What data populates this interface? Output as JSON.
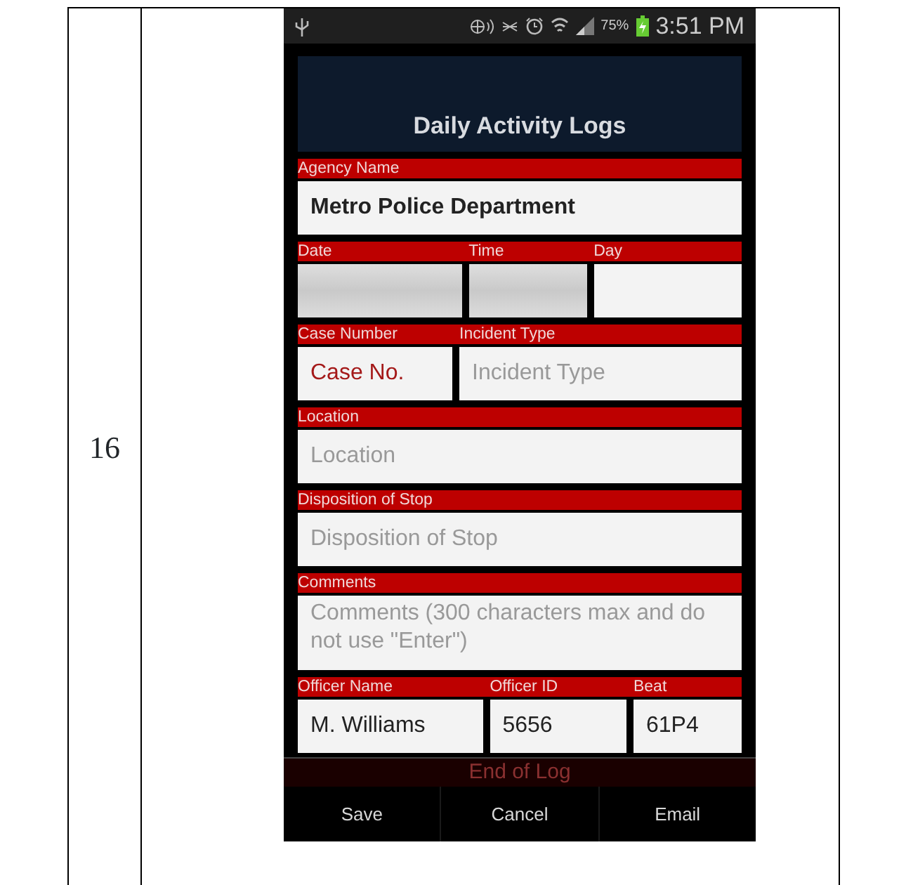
{
  "document_table": {
    "row_number": "16"
  },
  "status_bar": {
    "battery": "75%",
    "time": "3:51 PM"
  },
  "app": {
    "title": "Daily Activity Logs",
    "rows": [
      {
        "columns": [
          {
            "label": "Agency Name",
            "kind": "text",
            "value": "Metro Police Department",
            "bold": true
          }
        ]
      },
      {
        "columns": [
          {
            "label": "Date",
            "kind": "picker"
          },
          {
            "label": "Time",
            "kind": "picker"
          },
          {
            "label": "Day",
            "kind": "text"
          }
        ]
      },
      {
        "columns": [
          {
            "label": "Case Number",
            "kind": "text",
            "value": "Case No.",
            "bold": false,
            "invalid": true
          },
          {
            "label": "Incident Type",
            "kind": "text",
            "placeholder": "Incident Type"
          }
        ]
      },
      {
        "columns": [
          {
            "label": "Location",
            "kind": "text",
            "placeholder": "Location"
          }
        ]
      },
      {
        "columns": [
          {
            "label": "Disposition of Stop",
            "kind": "text",
            "placeholder": "Disposition of Stop"
          }
        ]
      },
      {
        "columns": [
          {
            "label": "Comments",
            "kind": "textarea",
            "placeholder": "Comments (300 characters max and do not use \"Enter\")"
          }
        ]
      },
      {
        "columns": [
          {
            "label": "Officer Name",
            "kind": "text",
            "value": "M. Williams",
            "bold": false
          },
          {
            "label": "Officer ID",
            "kind": "text",
            "value": "5656",
            "bold": false
          },
          {
            "label": "Beat",
            "kind": "text",
            "value": "61P4",
            "bold": false
          }
        ]
      }
    ],
    "hidden_button": "End of Log",
    "actions": [
      "Save",
      "Cancel",
      "Email"
    ]
  }
}
